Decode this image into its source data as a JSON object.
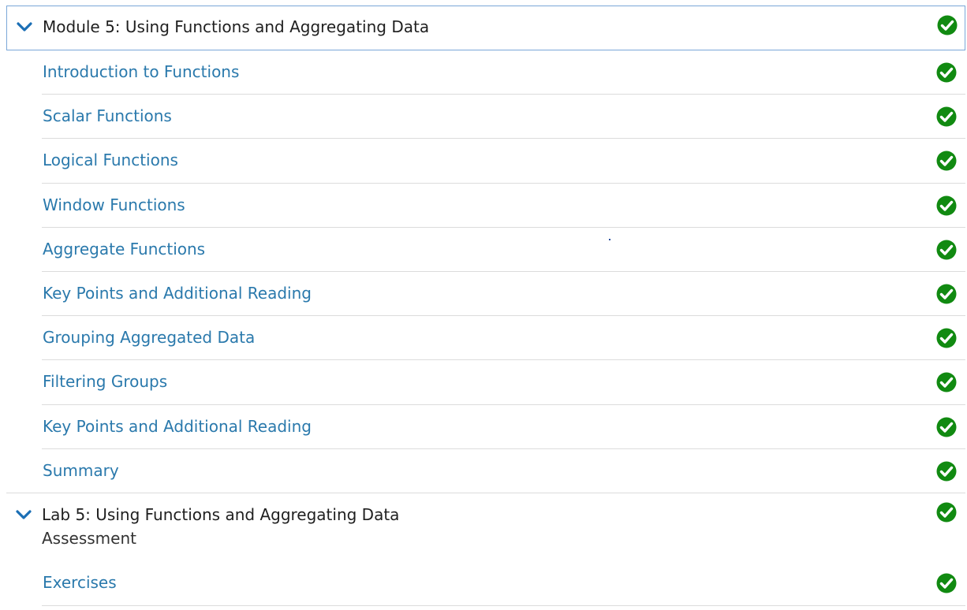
{
  "module": {
    "title": "Module 5: Using Functions and Aggregating Data",
    "expanded": true,
    "completed": true,
    "items": [
      {
        "label": "Introduction to Functions",
        "completed": true
      },
      {
        "label": "Scalar Functions",
        "completed": true
      },
      {
        "label": "Logical Functions",
        "completed": true
      },
      {
        "label": "Window Functions",
        "completed": true
      },
      {
        "label": "Aggregate Functions",
        "completed": true
      },
      {
        "label": "Key Points and Additional Reading",
        "completed": true
      },
      {
        "label": "Grouping Aggregated Data",
        "completed": true
      },
      {
        "label": "Filtering Groups",
        "completed": true
      },
      {
        "label": "Key Points and Additional Reading",
        "completed": true
      },
      {
        "label": "Summary",
        "completed": true
      }
    ]
  },
  "lab": {
    "title": "Lab 5: Using Functions and Aggregating Data",
    "subtitle": "Assessment",
    "expanded": true,
    "completed": true,
    "items": [
      {
        "label": "Exercises",
        "completed": true
      }
    ]
  },
  "icons": {
    "expand": "chevron-down-icon",
    "complete": "check-circle-icon"
  },
  "colors": {
    "link": "#2a79ac",
    "chevron": "#1b6fb5",
    "check": "#118a11",
    "active_border": "#7aa7d8",
    "divider": "#dcdcdc"
  }
}
